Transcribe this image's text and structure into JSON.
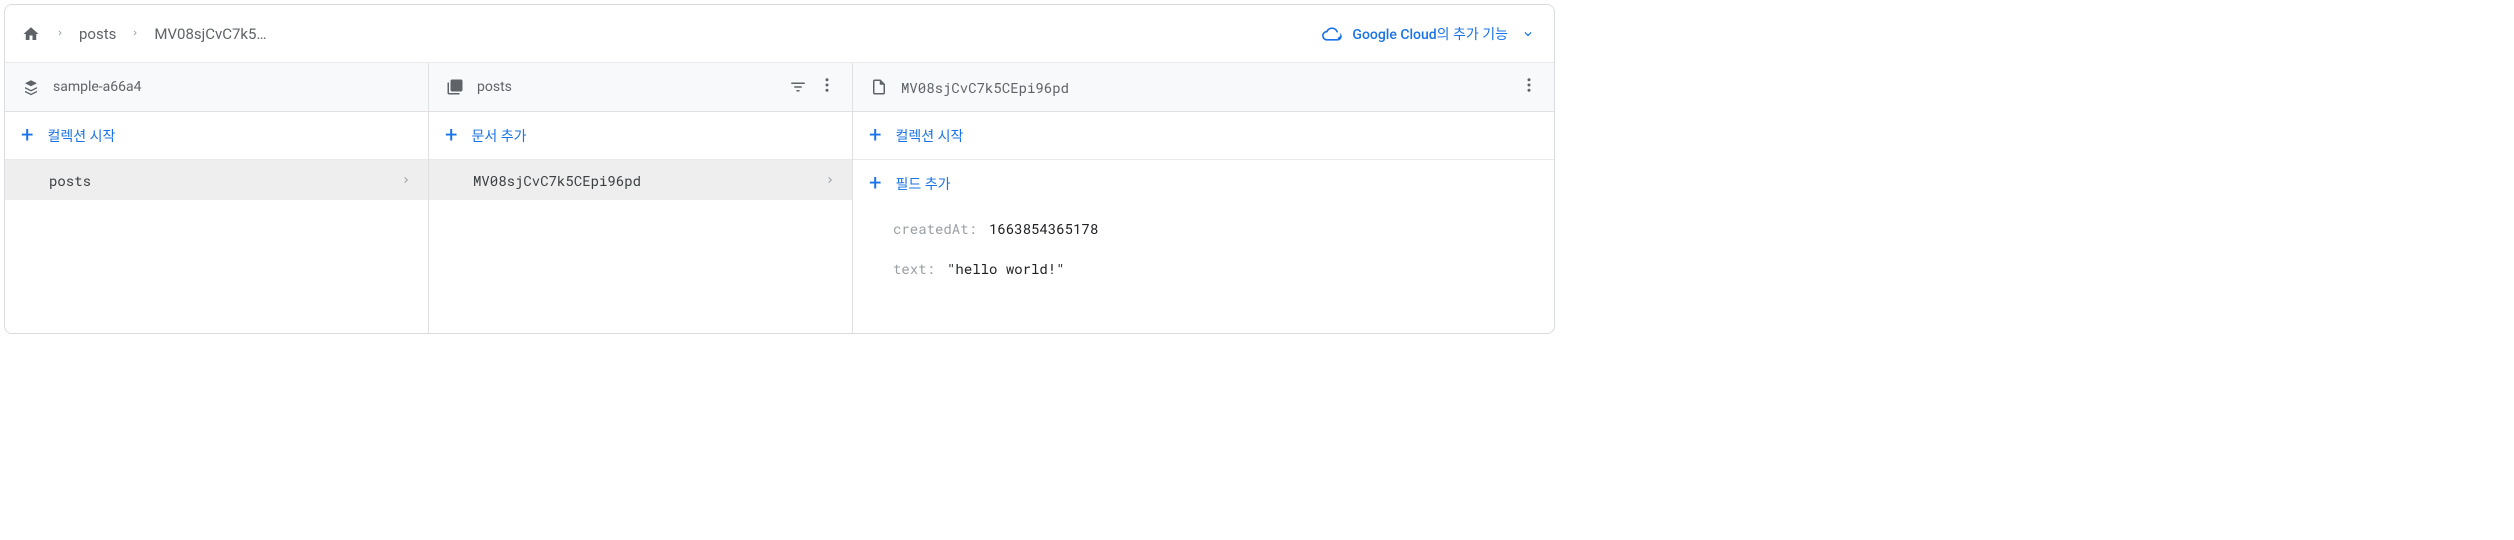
{
  "breadcrumb": {
    "items": [
      "posts",
      "MV08sjCvC7k5…"
    ]
  },
  "promo": {
    "label": "Google Cloud의 추가 기능"
  },
  "col_root": {
    "title": "sample-a66a4",
    "action": "컬렉션 시작",
    "items": [
      {
        "label": "posts",
        "selected": true
      }
    ]
  },
  "col_collection": {
    "title": "posts",
    "action": "문서 추가",
    "items": [
      {
        "label": "MV08sjCvC7k5CEpi96pd",
        "selected": true
      }
    ]
  },
  "col_doc": {
    "title": "MV08sjCvC7k5CEpi96pd",
    "action_collection": "컬렉션 시작",
    "action_field": "필드 추가",
    "fields": [
      {
        "key": "createdAt:",
        "value": "1663854365178"
      },
      {
        "key": "text:",
        "value": "\"hello world!\""
      }
    ]
  }
}
